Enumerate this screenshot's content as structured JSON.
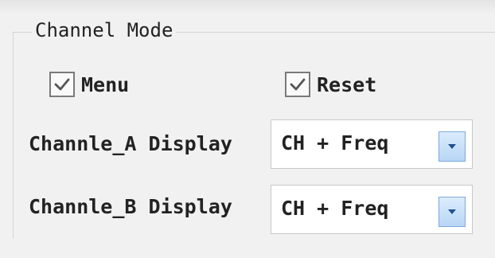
{
  "group": {
    "title": "Channel Mode"
  },
  "checkboxes": [
    {
      "label": "Menu",
      "checked": true
    },
    {
      "label": "Reset",
      "checked": true
    }
  ],
  "channel_a": {
    "label": "Channle_A Display",
    "value": "CH + Freq"
  },
  "channel_b": {
    "label": "Channle_B Display",
    "value": "CH + Freq"
  },
  "icons": {
    "check": "check-icon",
    "dropdown": "chevron-down-icon"
  },
  "colors": {
    "panel_bg": "#f1f1f1",
    "combo_button": "#b8d6f6",
    "arrow": "#1f4f8f"
  }
}
